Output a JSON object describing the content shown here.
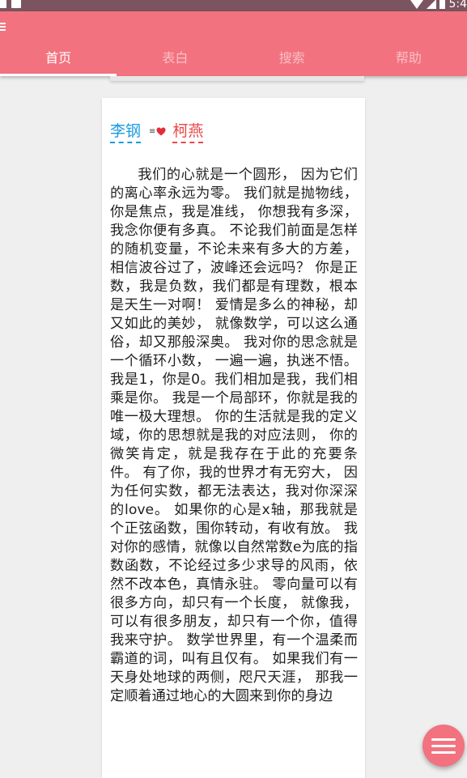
{
  "status_bar": {
    "time": "5:4"
  },
  "tabs": [
    {
      "label": "首页",
      "active": true
    },
    {
      "label": "表白",
      "active": false
    },
    {
      "label": "搜索",
      "active": false
    },
    {
      "label": "帮助",
      "active": false
    }
  ],
  "card": {
    "name_left": "李钢",
    "name_right": "柯燕",
    "poem": "我们的心就是一个圆形， 因为它们的离心率永远为零。 我们就是抛物线，你是焦点，我是准线， 你想我有多深，我念你便有多真。 不论我们前面是怎样的随机变量，不论未来有多大的方差， 相信波谷过了，波峰还会远吗？ 你是正数，我是负数，我们都是有理数，根本是天生一对啊！ 爱情是多么的神秘，却又如此的美妙， 就像数学，可以这么通俗，却又那般深奥。 我对你的思念就是一个循环小数， 一遍一遍，执迷不悟。 我是1，你是0。我们相加是我，我们相乘是你。 我是一个局部环，你就是我的唯一极大理想。 你的生活就是我的定义域，你的思想就是我的对应法则， 你的微笑肯定，就是我存在于此的充要条件。 有了你，我的世界才有无穷大， 因为任何实数，都无法表达，我对你深深的love。 如果你的心是x轴，那我就是个正弦函数，围你转动，有收有放。 我对你的感情，就像以自然常数e为底的指数函数，不论经过多少求导的风雨，依然不改本色，真情永驻。 零向量可以有很多方向，却只有一个长度， 就像我，可以有很多朋友，却只有一个你，值得我来守护。 数学世界里，有一个温柔而霸道的词，叫有且仅有。 如果我们有一天身处地球的两侧，咫尺天涯， 那我一定顺着通过地心的大圆来到你的身边"
  },
  "colors": {
    "accent": "#f2727f",
    "name_left": "#1a9be0",
    "name_right": "#e94848"
  },
  "icons": {
    "menu": "menu-icon",
    "heart": "heart-icon",
    "fab": "menu-icon"
  }
}
